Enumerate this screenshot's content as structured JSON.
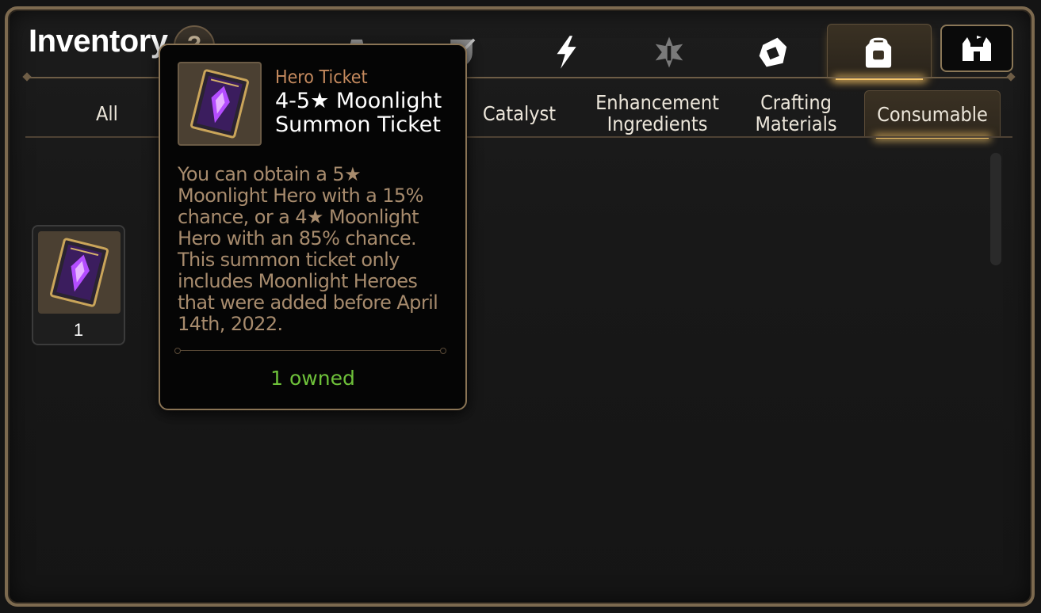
{
  "header": {
    "title": "Inventory",
    "help_icon_text": "?",
    "categories": [
      {
        "name": "gear-icon",
        "active": false
      },
      {
        "name": "sword-shield-icon",
        "active": false
      },
      {
        "name": "lightning-icon",
        "active": false
      },
      {
        "name": "rune-icon",
        "active": false
      },
      {
        "name": "crystal-icon",
        "active": false
      },
      {
        "name": "backpack-icon",
        "active": true
      }
    ],
    "shop_icon": "castle-shop-icon"
  },
  "tabs": [
    {
      "label": "All"
    },
    {
      "label": "Catalyst"
    },
    {
      "label": "Enhancement\nIngredients"
    },
    {
      "label": "Crafting\nMaterials"
    },
    {
      "label": "Consumable",
      "active": true
    }
  ],
  "items": [
    {
      "icon": "summon-ticket-icon",
      "count": "1"
    }
  ],
  "tooltip": {
    "type": "Hero Ticket",
    "name": "4-5★ Moonlight\nSummon Ticket",
    "description": "You can obtain a 5★ Moonlight Hero with a 15% chance, or a 4★ Moonlight Hero with an 85% chance. This summon ticket only includes Moonlight Heroes that were added before April 14th, 2022.",
    "owned": "1 owned"
  },
  "colors": {
    "accent_gold": "#f3c46a",
    "owned_green": "#6ec13a",
    "type_orange": "#c58a5e",
    "frame_border": "#7d6a4f"
  }
}
